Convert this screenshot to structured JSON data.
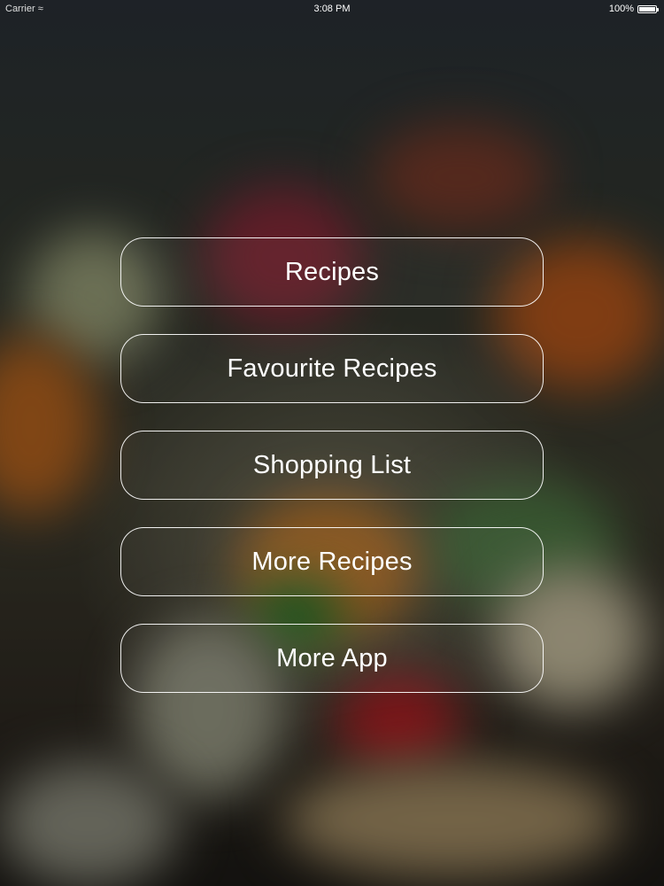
{
  "status_bar": {
    "carrier": "Carrier",
    "time": "3:08 PM",
    "battery": "100%",
    "icons": [
      "wifi-icon",
      "battery-icon"
    ]
  },
  "menu": {
    "buttons": [
      {
        "label": "Recipes"
      },
      {
        "label": "Favourite Recipes"
      },
      {
        "label": "Shopping List"
      },
      {
        "label": "More Recipes"
      },
      {
        "label": "More App"
      }
    ]
  },
  "colors": {
    "button_border": "#ffffff",
    "button_text": "#ffffff"
  }
}
